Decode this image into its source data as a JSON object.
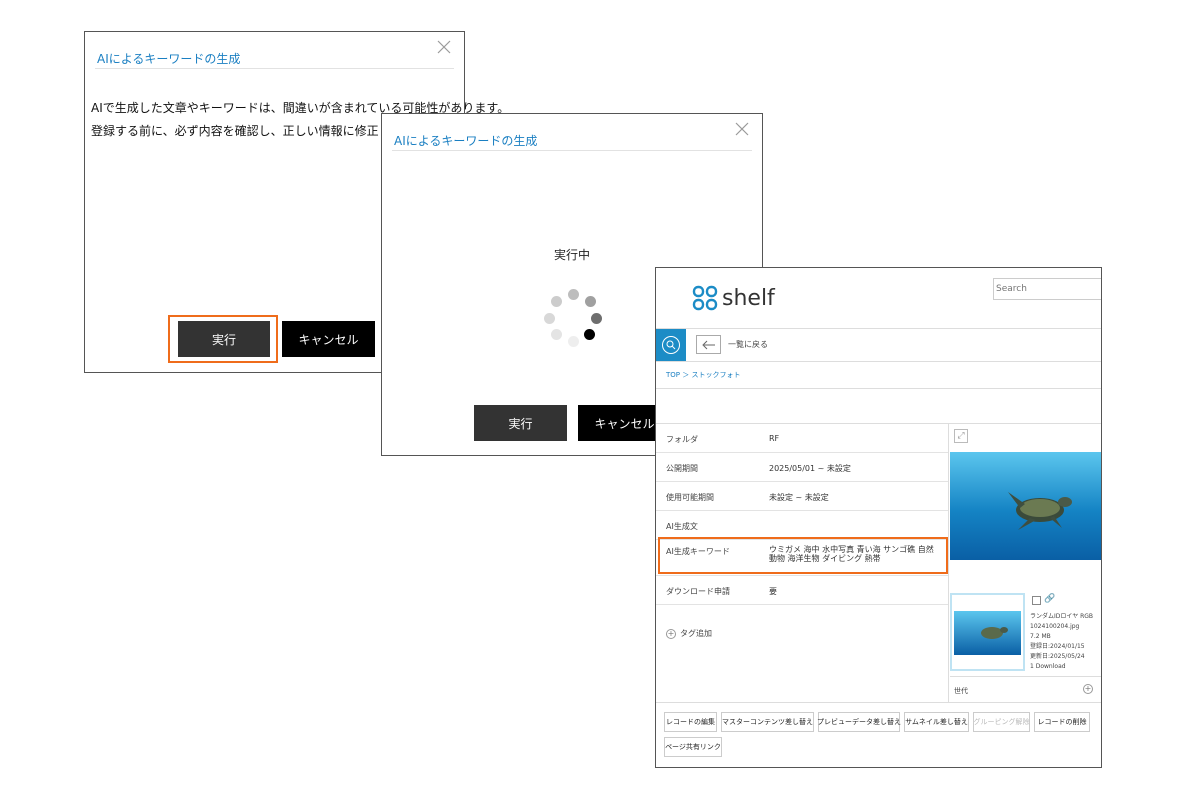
{
  "dialog1": {
    "title": "AIによるキーワードの生成",
    "line1": "AIで生成した文章やキーワードは、間違いが含まれている可能性があります。",
    "line2": "登録する前に、必ず内容を確認し、正しい情報に修正してください。",
    "exec_label": "実行",
    "cancel_label": "キャンセル",
    "close_icon": "close-icon"
  },
  "dialog2": {
    "title": "AIによるキーワードの生成",
    "status": "実行中",
    "exec_label": "実行",
    "cancel_label": "キャンセル",
    "spinner_icon": "loading-spinner"
  },
  "shelf": {
    "logo_text": "shelf",
    "search_placeholder": "Search",
    "back_label": "一覧に戻る",
    "breadcrumb": "TOP ＞ ストックフォト",
    "rows": [
      {
        "label": "フォルダ",
        "value": "RF"
      },
      {
        "label": "公開期間",
        "value": "2025/05/01 ~ 未設定"
      },
      {
        "label": "使用可能期間",
        "value": "未設定 ~ 未設定"
      },
      {
        "label": "AI生成文",
        "value": ""
      },
      {
        "label": "AI生成キーワード",
        "value": "ウミガメ 海中 水中写真 青い海 サンゴ礁 自然 動物 海洋生物 ダイビング 熱帯"
      },
      {
        "label": "ダウンロード申請",
        "value": "要"
      }
    ],
    "tag_add": "タグ追加",
    "thumb_info": [
      "ランダムIDロイヤ RGB",
      "1024100204.jpg",
      "7.2 MB",
      "登録日:2024/01/15",
      "更新日:2025/05/24",
      "1 Download"
    ],
    "generation_label": "世代",
    "actions": [
      "レコードの編集",
      "マスターコンテンツ差し替え",
      "プレビューデータ差し替え",
      "サムネイル差し替え",
      "グルーピング解除",
      "レコードの削除",
      "ページ共有リンク"
    ],
    "accent_color": "#1c8cc6",
    "highlight_color": "#ef6c1b"
  }
}
